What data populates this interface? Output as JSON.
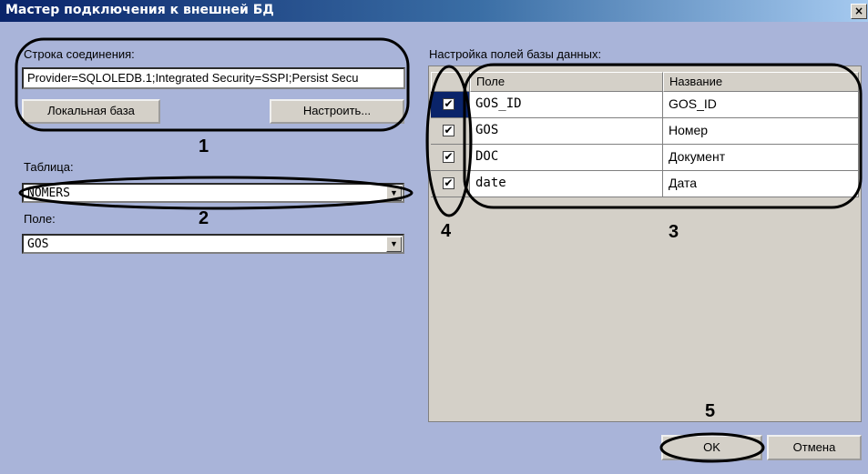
{
  "window": {
    "title": "Мастер подключения к внешней БД",
    "close_label": "×"
  },
  "connection": {
    "label": "Строка соединения:",
    "value": "Provider=SQLOLEDB.1;Integrated Security=SSPI;Persist Secu",
    "local_button": "Локальная база",
    "configure_button": "Настроить..."
  },
  "table": {
    "label": "Таблица:",
    "value": "NOMERS"
  },
  "field": {
    "label": "Поле:",
    "value": "GOS"
  },
  "grid": {
    "label": "Настройка полей базы данных:",
    "col_field": "Поле",
    "col_name": "Название",
    "rows": [
      {
        "checked": true,
        "field": "GOS_ID",
        "name": "GOS_ID"
      },
      {
        "checked": true,
        "field": "GOS",
        "name": "Номер"
      },
      {
        "checked": true,
        "field": "DOC",
        "name": "Документ"
      },
      {
        "checked": true,
        "field": "date",
        "name": "Дата"
      }
    ]
  },
  "buttons": {
    "ok": "OK",
    "cancel": "Отмена"
  },
  "annotations": {
    "n1": "1",
    "n2": "2",
    "n3": "3",
    "n4": "4",
    "n5": "5"
  },
  "colors": {
    "background": "#a9b4d9",
    "titlebar": "#0a246a",
    "annotation": "#000000"
  },
  "icons": {
    "checkbox": "✔",
    "dropdown": "▼"
  }
}
